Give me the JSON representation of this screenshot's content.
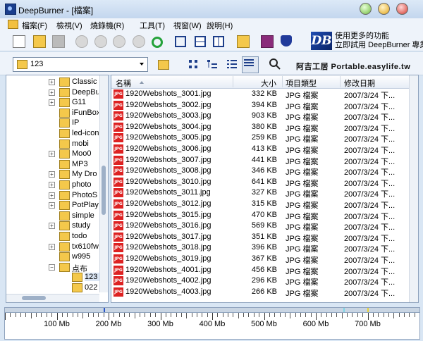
{
  "window": {
    "title": "DeepBurner - [檔案]"
  },
  "menu": [
    "檔案(F)",
    "檢視(V)",
    "燒錄機(R)",
    "工具(T)",
    "視窗(W)",
    "說明(H)"
  ],
  "promo": {
    "logo": "DB",
    "line1": "使用更多的功能",
    "line2": "立即試用 DeepBurner 專業"
  },
  "path": {
    "value": "123"
  },
  "watermark": "阿吉工居 Portable.easylife.tw",
  "tree": [
    {
      "label": "Classic",
      "expandable": true
    },
    {
      "label": "DeepBu",
      "expandable": true
    },
    {
      "label": "G11",
      "expandable": true
    },
    {
      "label": "iFunBox",
      "expandable": false
    },
    {
      "label": "IP",
      "expandable": false
    },
    {
      "label": "led-icon",
      "expandable": false
    },
    {
      "label": "mobi",
      "expandable": false
    },
    {
      "label": "Moo0",
      "expandable": true
    },
    {
      "label": "MP3",
      "expandable": false
    },
    {
      "label": "My Dro",
      "expandable": true
    },
    {
      "label": "photo",
      "expandable": true
    },
    {
      "label": "PhotoS",
      "expandable": true
    },
    {
      "label": "PotPlay",
      "expandable": true
    },
    {
      "label": "simple",
      "expandable": false
    },
    {
      "label": "study",
      "expandable": true
    },
    {
      "label": "todo",
      "expandable": false
    },
    {
      "label": "tx610fw",
      "expandable": true
    },
    {
      "label": "w995",
      "expandable": false
    },
    {
      "label": "点布",
      "expandable": true,
      "expanded": true
    },
    {
      "label": "123",
      "expandable": false,
      "child": true,
      "selected": true
    },
    {
      "label": "022",
      "expandable": false,
      "child": true
    }
  ],
  "columns": {
    "name": "名稱",
    "size": "大小",
    "type": "項目類型",
    "date": "修改日期"
  },
  "files": [
    {
      "name": "1920Webshots_3001.jpg",
      "size": "332 KB",
      "type": "JPG 檔案",
      "date": "2007/3/24 下..."
    },
    {
      "name": "1920Webshots_3002.jpg",
      "size": "394 KB",
      "type": "JPG 檔案",
      "date": "2007/3/24 下..."
    },
    {
      "name": "1920Webshots_3003.jpg",
      "size": "903 KB",
      "type": "JPG 檔案",
      "date": "2007/3/24 下..."
    },
    {
      "name": "1920Webshots_3004.jpg",
      "size": "380 KB",
      "type": "JPG 檔案",
      "date": "2007/3/24 下..."
    },
    {
      "name": "1920Webshots_3005.jpg",
      "size": "259 KB",
      "type": "JPG 檔案",
      "date": "2007/3/24 下..."
    },
    {
      "name": "1920Webshots_3006.jpg",
      "size": "413 KB",
      "type": "JPG 檔案",
      "date": "2007/3/24 下..."
    },
    {
      "name": "1920Webshots_3007.jpg",
      "size": "441 KB",
      "type": "JPG 檔案",
      "date": "2007/3/24 下..."
    },
    {
      "name": "1920Webshots_3008.jpg",
      "size": "346 KB",
      "type": "JPG 檔案",
      "date": "2007/3/24 下..."
    },
    {
      "name": "1920Webshots_3010.jpg",
      "size": "641 KB",
      "type": "JPG 檔案",
      "date": "2007/3/24 下..."
    },
    {
      "name": "1920Webshots_3011.jpg",
      "size": "327 KB",
      "type": "JPG 檔案",
      "date": "2007/3/24 下..."
    },
    {
      "name": "1920Webshots_3012.jpg",
      "size": "315 KB",
      "type": "JPG 檔案",
      "date": "2007/3/24 下..."
    },
    {
      "name": "1920Webshots_3015.jpg",
      "size": "470 KB",
      "type": "JPG 檔案",
      "date": "2007/3/24 下..."
    },
    {
      "name": "1920Webshots_3016.jpg",
      "size": "569 KB",
      "type": "JPG 檔案",
      "date": "2007/3/24 下..."
    },
    {
      "name": "1920Webshots_3017.jpg",
      "size": "351 KB",
      "type": "JPG 檔案",
      "date": "2007/3/24 下..."
    },
    {
      "name": "1920Webshots_3018.jpg",
      "size": "396 KB",
      "type": "JPG 檔案",
      "date": "2007/3/24 下..."
    },
    {
      "name": "1920Webshots_3019.jpg",
      "size": "367 KB",
      "type": "JPG 檔案",
      "date": "2007/3/24 下..."
    },
    {
      "name": "1920Webshots_4001.jpg",
      "size": "456 KB",
      "type": "JPG 檔案",
      "date": "2007/3/24 下..."
    },
    {
      "name": "1920Webshots_4002.jpg",
      "size": "296 KB",
      "type": "JPG 檔案",
      "date": "2007/3/24 下..."
    },
    {
      "name": "1920Webshots_4003.jpg",
      "size": "266 KB",
      "type": "JPG 檔案",
      "date": "2007/3/24 下..."
    }
  ],
  "file_icon_text": "JPG",
  "ruler": {
    "labels": [
      "100 Mb",
      "200 Mb",
      "300 Mb",
      "400 Mb",
      "500 Mb",
      "600 Mb",
      "700 Mb"
    ]
  },
  "colors": {
    "file_icon": "#dd2222",
    "folder": "#f4c84b",
    "refresh": "#24a23a"
  },
  "icons": [
    "new-icon",
    "open-icon",
    "save-icon",
    "burn-icon",
    "erase-icon",
    "copy-disc-icon",
    "disc-info-icon",
    "refresh-icon",
    "cascade-icon",
    "tile-horizontal-icon",
    "tile-vertical-icon",
    "folder-icon",
    "book-icon",
    "shield-icon",
    "up-folder-icon",
    "large-icons-view-icon",
    "tree-view-icon",
    "list-view-icon",
    "details-view-icon",
    "search-icon"
  ]
}
